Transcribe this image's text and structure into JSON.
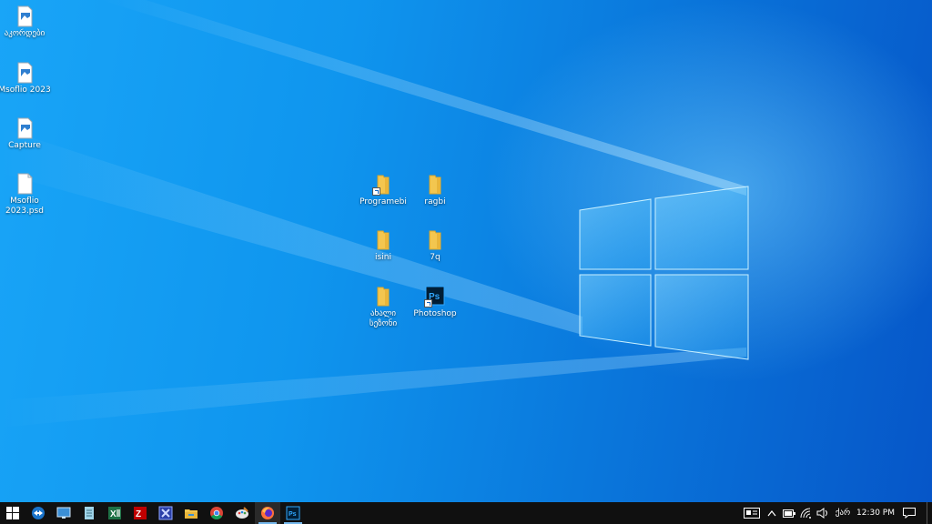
{
  "desktop": {
    "left_icons": [
      {
        "label": "აკორდები",
        "icon": "image-file-icon"
      },
      {
        "label": "Msoflio 2023",
        "icon": "image-file-icon"
      },
      {
        "label": "Capture",
        "icon": "image-file-icon"
      },
      {
        "label": "Msoflio 2023.psd",
        "icon": "blank-file-icon"
      }
    ],
    "center_icons": [
      {
        "label": "Programebi",
        "icon": "folder-shortcut-icon"
      },
      {
        "label": "ragbi",
        "icon": "folder-icon"
      },
      {
        "label": "isini",
        "icon": "folder-icon"
      },
      {
        "label": "7q",
        "icon": "folder-icon"
      },
      {
        "label": "ახალი სეზონი",
        "icon": "folder-icon"
      },
      {
        "label": "Photoshop",
        "icon": "photoshop-shortcut-icon"
      }
    ]
  },
  "taskbar": {
    "apps": [
      {
        "name": "start",
        "icon": "windows-start-icon"
      },
      {
        "name": "teamviewer",
        "icon": "teamviewer-icon"
      },
      {
        "name": "remote-desktop",
        "icon": "remote-desktop-icon"
      },
      {
        "name": "notepad",
        "icon": "notepad-icon"
      },
      {
        "name": "excel",
        "icon": "excel-icon"
      },
      {
        "name": "filezilla",
        "icon": "filezilla-icon"
      },
      {
        "name": "virtualbox",
        "icon": "app-icon"
      },
      {
        "name": "file-explorer",
        "icon": "folder-icon"
      },
      {
        "name": "chrome",
        "icon": "chrome-icon"
      },
      {
        "name": "paint",
        "icon": "paint-icon"
      },
      {
        "name": "firefox",
        "icon": "firefox-icon"
      },
      {
        "name": "photoshop",
        "icon": "photoshop-icon"
      }
    ],
    "language": "ქარ",
    "clock": "12:30 PM",
    "colors": {
      "background": "#101010",
      "active_underline": "#76b9ed",
      "photoshop_blue": "#31a8ff",
      "excel_green": "#1e7145",
      "filezilla_red": "#bf0000"
    }
  }
}
